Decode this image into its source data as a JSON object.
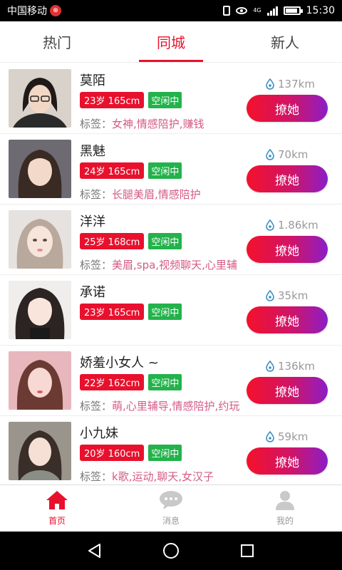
{
  "status_bar": {
    "carrier": "中国移动",
    "network": "4G",
    "time": "15:30"
  },
  "tabs": [
    {
      "label": "热门",
      "active": false
    },
    {
      "label": "同城",
      "active": true
    },
    {
      "label": "新人",
      "active": false
    }
  ],
  "people": [
    {
      "name": "莫陌",
      "age_height": "23岁  165cm",
      "status": "空闲中",
      "tags_label": "标签：",
      "tags": "女神,情感陪护,赚钱",
      "distance": "137km",
      "action": "撩她"
    },
    {
      "name": "黑魅",
      "age_height": "24岁  165cm",
      "status": "空闲中",
      "tags_label": "标签：",
      "tags": "长腿美眉,情感陪护",
      "distance": "70km",
      "action": "撩她"
    },
    {
      "name": "洋洋",
      "age_height": "25岁  168cm",
      "status": "空闲中",
      "tags_label": "标签：",
      "tags": "美眉,spa,视频聊天,心里辅",
      "distance": "1.86km",
      "action": "撩她"
    },
    {
      "name": "承诺",
      "age_height": "23岁  165cm",
      "status": "空闲中",
      "tags_label": "",
      "tags": "",
      "distance": "35km",
      "action": "撩她"
    },
    {
      "name": "娇羞小女人 ~",
      "age_height": "22岁  162cm",
      "status": "空闲中",
      "tags_label": "标签：",
      "tags": "萌,心里辅导,情感陪护,约玩",
      "distance": "136km",
      "action": "撩她"
    },
    {
      "name": "小九妹",
      "age_height": "20岁  160cm",
      "status": "空闲中",
      "tags_label": "标签：",
      "tags": "k歌,运动,聊天,女汉子",
      "distance": "59km",
      "action": "撩她"
    }
  ],
  "bottom_nav": [
    {
      "label": "首页",
      "icon": "home-icon",
      "active": true
    },
    {
      "label": "消息",
      "icon": "message-icon",
      "active": false
    },
    {
      "label": "我的",
      "icon": "profile-icon",
      "active": false
    }
  ],
  "colors": {
    "accent": "#e8112d",
    "status_green": "#23b24b",
    "tag_pink": "#d45a86",
    "button_gradient_end": "#8c1ec7"
  }
}
